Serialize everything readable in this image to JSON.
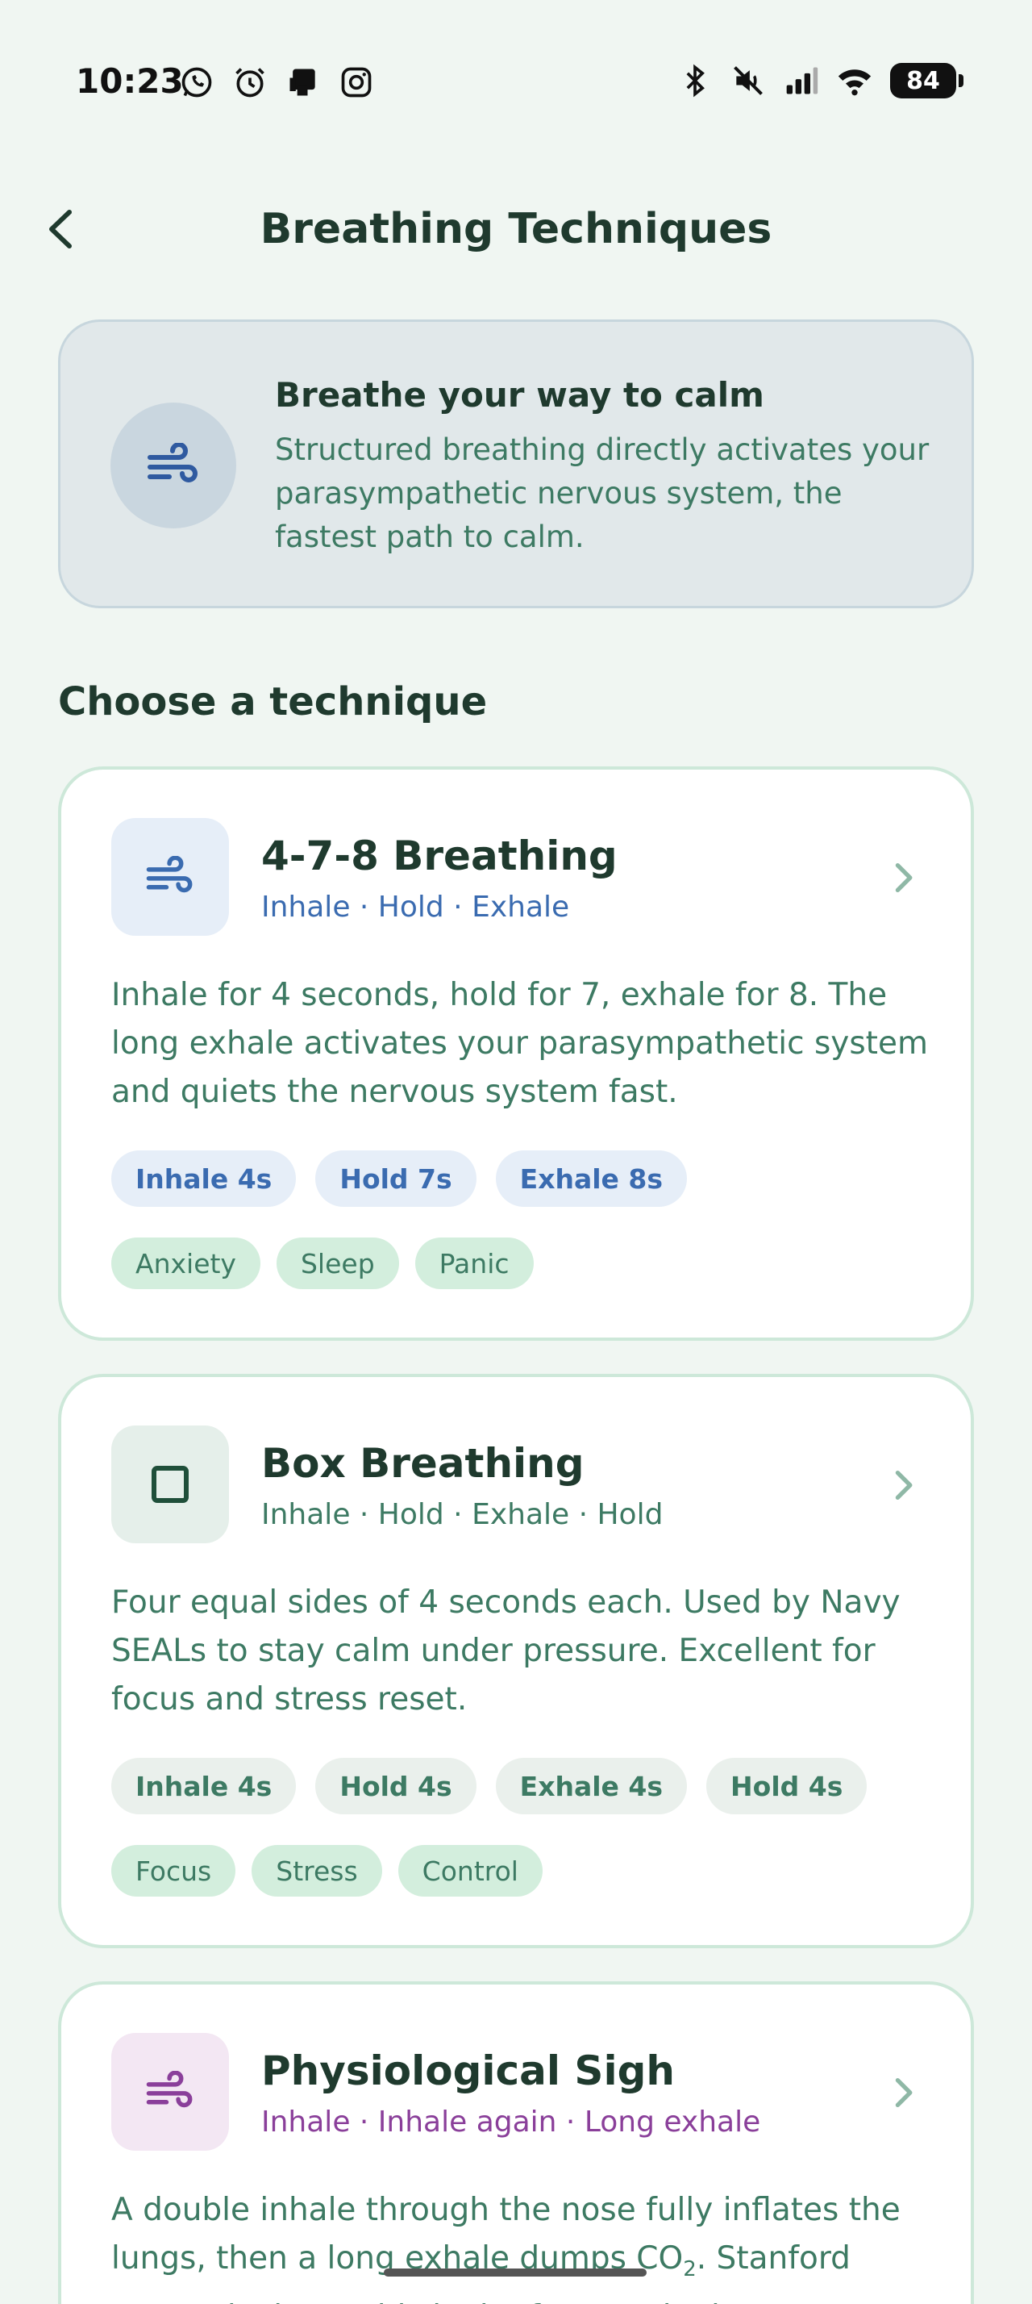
{
  "status_bar": {
    "time": "10:23",
    "left_icons": [
      "whatsapp-icon",
      "alarm-icon",
      "device-icon",
      "instagram-icon"
    ],
    "right_icons": [
      "bluetooth-icon",
      "mute-icon",
      "signal-icon",
      "wifi-icon"
    ],
    "battery": "84"
  },
  "header": {
    "title": "Breathing Techniques",
    "back_icon": "chevron-left-icon"
  },
  "intro": {
    "icon": "wind-icon",
    "title": "Breathe your way to calm",
    "text": "Structured breathing directly activates your parasympathetic nervous system, the fastest path to calm."
  },
  "section_title": "Choose a technique",
  "colors": {
    "background": "#f0f6f2",
    "text_dark": "#1f3a2e",
    "text_green": "#3d7a63",
    "blue": "#3a6bb0",
    "purple": "#8a3f9a",
    "card_border": "#cde8d9"
  },
  "techniques": [
    {
      "title": "4-7-8 Breathing",
      "subtitle": "Inhale · Hold · Exhale",
      "description": "Inhale for 4 seconds, hold for 7, exhale for 8. The long exhale activates your parasympathetic system and quiets the nervous system fast.",
      "steps": [
        "Inhale 4s",
        "Hold 7s",
        "Exhale 8s"
      ],
      "tags": [
        "Anxiety",
        "Sleep",
        "Panic"
      ]
    },
    {
      "title": "Box Breathing",
      "subtitle": "Inhale · Hold · Exhale · Hold",
      "description": "Four equal sides of 4 seconds each. Used by Navy SEALs to stay calm under pressure. Excellent for focus and stress reset.",
      "steps": [
        "Inhale 4s",
        "Hold 4s",
        "Exhale 4s",
        "Hold 4s"
      ],
      "tags": [
        "Focus",
        "Stress",
        "Control"
      ]
    },
    {
      "title": "Physiological Sigh",
      "subtitle": "Inhale · Inhale again · Long exhale",
      "description_a": "A double inhale through the nose fully inflates the lungs, then a long exhale dumps CO",
      "description_sub": "2",
      "description_b": ". Stanford research shows this is the fastest single"
    }
  ]
}
